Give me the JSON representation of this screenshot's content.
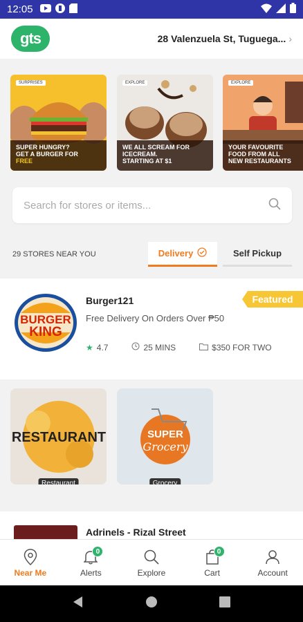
{
  "statusbar": {
    "time": "12:05"
  },
  "header": {
    "logo_text": "gts",
    "address": "28 Valenzuela St, Tuguega...",
    "chevron": "›"
  },
  "banners": [
    {
      "tag": "SURPRISES",
      "line1": "SUPER HUNGRY?",
      "line2": "GET A BURGER FOR",
      "line3": "FREE"
    },
    {
      "tag": "EXPLORE",
      "line1": "WE ALL SCREAM FOR",
      "line2": "ICECREAM.",
      "line3": "STARTING AT $1"
    },
    {
      "tag": "EXPLORE",
      "line1": "YOUR FAVOURITE",
      "line2": "FOOD FROM ALL",
      "line3": "NEW RESTAURANTS"
    }
  ],
  "search": {
    "placeholder": "Search for stores or items..."
  },
  "filters": {
    "count_label": "29 STORES NEAR YOU",
    "delivery_label": "Delivery",
    "pickup_label": "Self Pickup"
  },
  "store": {
    "logo_text_top": "BURGER",
    "logo_text_bottom": "KING",
    "name": "Burger121",
    "offer": "Free Delivery On Orders Over ₱50",
    "rating": "4.7",
    "time": "25 MINS",
    "price": "$350 FOR TWO",
    "featured_label": "Featured"
  },
  "categories": [
    {
      "label": "Restaurant",
      "art_text": "RESTAURANT"
    },
    {
      "label": "Grocery",
      "art_text_top": "SUPER",
      "art_text_bottom": "Grocery"
    }
  ],
  "store2": {
    "name": "Adrinels - Rizal Street"
  },
  "bottomnav": [
    {
      "label": "Near Me",
      "icon": "location-pin-icon",
      "active": true
    },
    {
      "label": "Alerts",
      "icon": "bell-icon",
      "badge": "0"
    },
    {
      "label": "Explore",
      "icon": "search-icon"
    },
    {
      "label": "Cart",
      "icon": "cart-icon",
      "badge": "0"
    },
    {
      "label": "Account",
      "icon": "person-icon"
    }
  ],
  "colors": {
    "accent": "#f07a1e",
    "brand_green": "#2eb36b",
    "statusbar": "#2f35a6",
    "featured": "#f7c634"
  }
}
